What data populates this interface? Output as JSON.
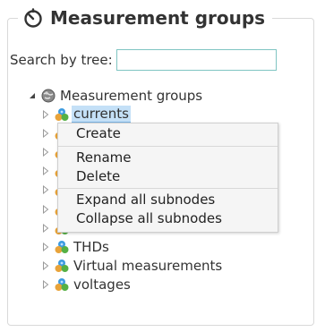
{
  "panel": {
    "title": "Measurement groups",
    "title_icon": "timer-icon"
  },
  "search": {
    "label": "Search by tree:",
    "value": "",
    "placeholder": ""
  },
  "tree": {
    "root": {
      "label": "Measurement groups",
      "icon": "globe-icon",
      "expanded": true
    },
    "items": [
      {
        "label": "currents",
        "icon": "group-icon",
        "selected": true
      },
      {
        "label": "",
        "icon": "group-icon"
      },
      {
        "label": "",
        "icon": "group-icon"
      },
      {
        "label": "",
        "icon": "group-icon"
      },
      {
        "label": "",
        "icon": "group-icon"
      },
      {
        "label": "",
        "icon": "group-icon"
      },
      {
        "label": "",
        "icon": "group-icon"
      },
      {
        "label": "THDs",
        "icon": "group-icon"
      },
      {
        "label": "Virtual measurements",
        "icon": "group-icon"
      },
      {
        "label": "voltages",
        "icon": "group-icon"
      }
    ]
  },
  "context_menu": {
    "items": [
      "Create",
      "Rename",
      "Delete",
      "Expand all subnodes",
      "Collapse all subnodes"
    ]
  },
  "colors": {
    "selection": "#c4e0f7",
    "input_border": "#7fc5c2",
    "menu_bg": "#f5f5f5"
  }
}
